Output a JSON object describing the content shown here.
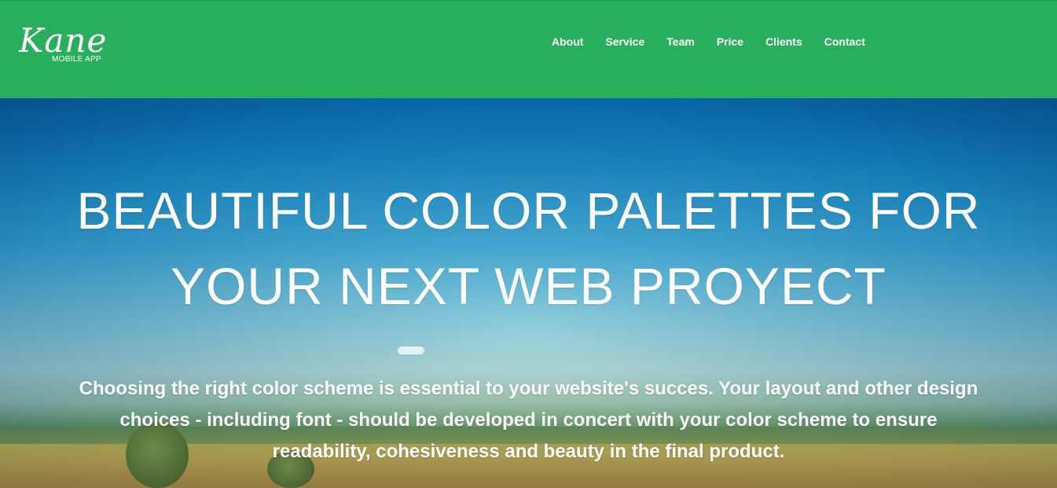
{
  "header": {
    "logo_script": "Kane",
    "logo_sub": "MOBILE APP",
    "background_color": "#29af5c",
    "nav": [
      {
        "label": "About"
      },
      {
        "label": "Service"
      },
      {
        "label": "Team"
      },
      {
        "label": "Price"
      },
      {
        "label": "Clients"
      },
      {
        "label": "Contact"
      }
    ]
  },
  "hero": {
    "title_line1": "BEAUTIFUL COLOR PALETTES FOR",
    "title_line2": "YOUR NEXT WEB PROYECT",
    "description": "Choosing the right color scheme is essential to your website's succes. Your layout and other design choices - including font - should be developed in concert with your color scheme to ensure readability, cohesiveness and beauty in the final product."
  }
}
